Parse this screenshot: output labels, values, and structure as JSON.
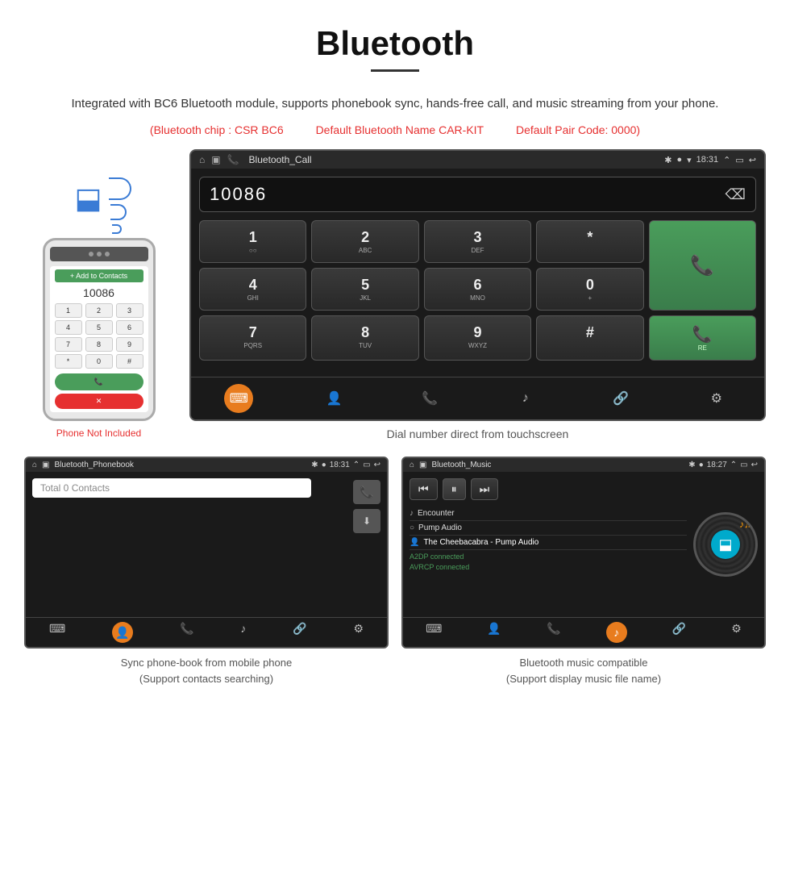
{
  "page": {
    "title": "Bluetooth",
    "description": "Integrated with BC6 Bluetooth module, supports phonebook sync, hands-free call, and music streaming from your phone.",
    "specs": {
      "chip": "(Bluetooth chip : CSR BC6",
      "name": "Default Bluetooth Name CAR-KIT",
      "code": "Default Pair Code: 0000)"
    },
    "phone_not_included": "Phone Not Included"
  },
  "car_screen": {
    "statusbar": {
      "title": "Bluetooth_Call",
      "time": "18:31"
    },
    "dial_number": "10086",
    "backspace_label": "⌫",
    "keys": [
      {
        "main": "1",
        "sub": "○○"
      },
      {
        "main": "2",
        "sub": "ABC"
      },
      {
        "main": "3",
        "sub": "DEF"
      },
      {
        "main": "*",
        "sub": ""
      },
      {
        "main": "📞",
        "sub": "",
        "type": "call-green"
      },
      {
        "main": "4",
        "sub": "GHI"
      },
      {
        "main": "5",
        "sub": "JKL"
      },
      {
        "main": "6",
        "sub": "MNO"
      },
      {
        "main": "0",
        "sub": "+"
      },
      {
        "main": "7",
        "sub": "PQRS"
      },
      {
        "main": "8",
        "sub": "TUV"
      },
      {
        "main": "9",
        "sub": "WXYZ"
      },
      {
        "main": "#",
        "sub": ""
      },
      {
        "main": "📞",
        "sub": "RE",
        "type": "redial-green"
      }
    ],
    "bottom_nav": [
      "⌨",
      "👤",
      "📞",
      "♪",
      "🔗",
      "⚙"
    ],
    "caption": "Dial number direct from touchscreen"
  },
  "phonebook_screen": {
    "statusbar": {
      "title": "Bluetooth_Phonebook",
      "time": "18:31"
    },
    "search_placeholder": "Total 0 Contacts",
    "caption_line1": "Sync phone-book from mobile phone",
    "caption_line2": "(Support contacts searching)"
  },
  "music_screen": {
    "statusbar": {
      "title": "Bluetooth_Music",
      "time": "18:27"
    },
    "tracks": [
      {
        "icon": "♪",
        "name": "Encounter"
      },
      {
        "icon": "○",
        "name": "Pump Audio"
      },
      {
        "icon": "👤",
        "name": "The Cheebacabra - Pump Audio",
        "highlight": true
      }
    ],
    "connected": [
      "A2DP connected",
      "AVRCP connected"
    ],
    "caption_line1": "Bluetooth music compatible",
    "caption_line2": "(Support display music file name)"
  }
}
